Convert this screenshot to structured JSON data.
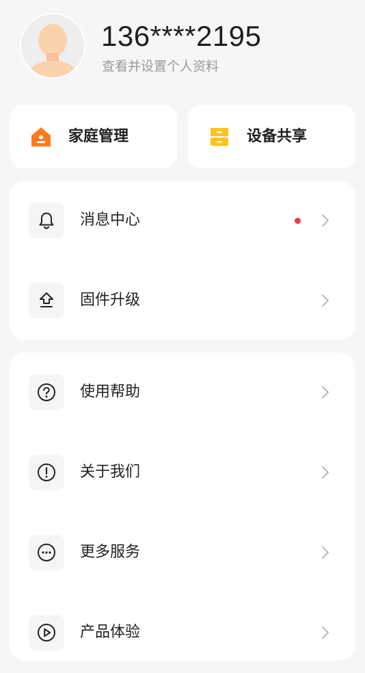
{
  "profile": {
    "phone": "136****2195",
    "subtitle": "查看并设置个人资料"
  },
  "quick_actions": [
    {
      "label": "家庭管理",
      "icon": "home-icon"
    },
    {
      "label": "设备共享",
      "icon": "device-share-icon"
    }
  ],
  "menu_group_1": [
    {
      "label": "消息中心",
      "icon": "bell-icon",
      "has_badge": true
    },
    {
      "label": "固件升级",
      "icon": "upgrade-arrow-icon",
      "has_badge": false
    }
  ],
  "menu_group_2": [
    {
      "label": "使用帮助",
      "icon": "question-circle-icon"
    },
    {
      "label": "关于我们",
      "icon": "info-exclamation-icon"
    },
    {
      "label": "更多服务",
      "icon": "more-dots-icon"
    },
    {
      "label": "产品体验",
      "icon": "play-circle-icon"
    }
  ],
  "colors": {
    "background": "#f6f6f6",
    "card": "#ffffff",
    "home_icon": "#ff7a1a",
    "share_icon": "#ffc21a",
    "badge": "#ee3a4a",
    "subtitle_text": "#9a9a9a",
    "chevron": "#b8b8b8"
  }
}
